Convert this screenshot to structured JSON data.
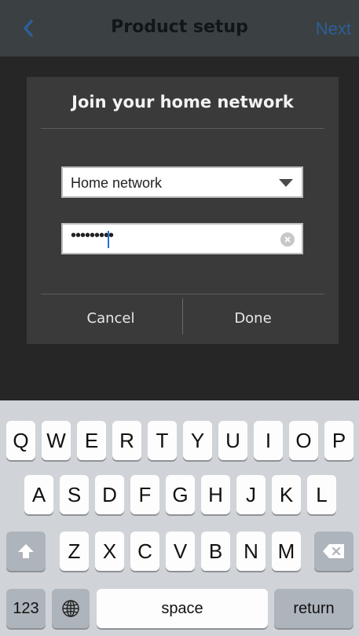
{
  "nav": {
    "title": "Product setup",
    "next_label": "Next"
  },
  "dialog": {
    "title": "Join your home network",
    "network_select_value": "Home network",
    "password_value": "•••••••••",
    "cancel_label": "Cancel",
    "done_label": "Done"
  },
  "keyboard": {
    "row1": [
      "Q",
      "W",
      "E",
      "R",
      "T",
      "Y",
      "U",
      "I",
      "O",
      "P"
    ],
    "row2": [
      "A",
      "S",
      "D",
      "F",
      "G",
      "H",
      "J",
      "K",
      "L"
    ],
    "row3": [
      "Z",
      "X",
      "C",
      "V",
      "B",
      "N",
      "M"
    ],
    "numbers_label": "123",
    "space_label": "space",
    "return_label": "return"
  },
  "colors": {
    "nav_background": "#3b4042",
    "accent": "#2c5f9a",
    "dialog_background": "#3a3a3a",
    "keyboard_background": "#d0d3d8"
  },
  "icons": [
    "back-chevron-icon",
    "dropdown-arrow-icon",
    "clear-icon",
    "shift-icon",
    "globe-icon",
    "backspace-icon"
  ]
}
